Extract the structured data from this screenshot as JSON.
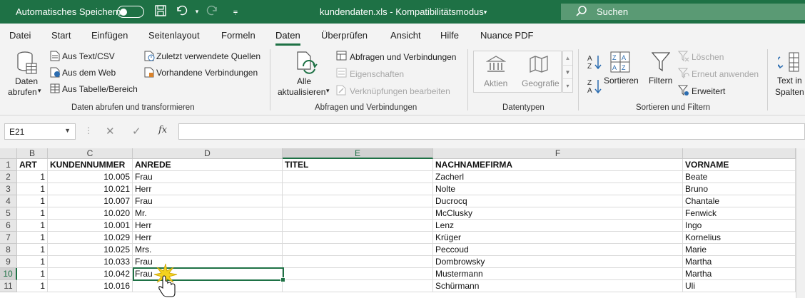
{
  "titlebar": {
    "autosave_label": "Automatisches Speichern",
    "doc_title": "kundendaten.xls  -  Kompatibilitätsmodus",
    "search_label": "Suchen"
  },
  "tabs": [
    "Datei",
    "Start",
    "Einfügen",
    "Seitenlayout",
    "Formeln",
    "Daten",
    "Überprüfen",
    "Ansicht",
    "Hilfe",
    "Nuance PDF"
  ],
  "ribbon": {
    "get_data": {
      "big_line1": "Daten",
      "big_line2": "abrufen",
      "from_text": "Aus Text/CSV",
      "from_web": "Aus dem Web",
      "from_table": "Aus Tabelle/Bereich",
      "recent_sources": "Zuletzt verwendete Quellen",
      "existing_connections": "Vorhandene Verbindungen",
      "group_label": "Daten abrufen und transformieren"
    },
    "queries": {
      "refresh_line1": "Alle",
      "refresh_line2": "aktualisieren",
      "queries_connections": "Abfragen und Verbindungen",
      "properties": "Eigenschaften",
      "edit_links": "Verknüpfungen bearbeiten",
      "group_label": "Abfragen und Verbindungen"
    },
    "datatypes": {
      "stocks": "Aktien",
      "geography": "Geografie",
      "group_label": "Datentypen"
    },
    "sort_filter": {
      "sort": "Sortieren",
      "filter": "Filtern",
      "clear": "Löschen",
      "reapply": "Erneut anwenden",
      "advanced": "Erweitert",
      "group_label": "Sortieren und Filtern"
    },
    "tools": {
      "text_line1": "Text in",
      "text_line2": "Spalten"
    }
  },
  "formula_bar": {
    "name_box": "E21",
    "fx": "fx",
    "value": ""
  },
  "grid": {
    "columns": [
      "B",
      "C",
      "D",
      "E",
      "F"
    ],
    "active_column": "E",
    "rows": [
      {
        "n": "1",
        "art": "ART",
        "kdnr": "KUNDENNUMMER",
        "anrede": "ANREDE",
        "titel": "TITEL",
        "name": "NACHNAMEFIRMA",
        "vorname": "VORNAME"
      },
      {
        "n": "2",
        "art": "1",
        "kdnr": "10.005",
        "anrede": "Frau",
        "titel": "",
        "name": "Zacherl",
        "vorname": "Beate"
      },
      {
        "n": "3",
        "art": "1",
        "kdnr": "10.021",
        "anrede": "Herr",
        "titel": "",
        "name": "Nolte",
        "vorname": "Bruno"
      },
      {
        "n": "4",
        "art": "1",
        "kdnr": "10.007",
        "anrede": "Frau",
        "titel": "",
        "name": "Ducrocq",
        "vorname": "Chantale"
      },
      {
        "n": "5",
        "art": "1",
        "kdnr": "10.020",
        "anrede": "Mr.",
        "titel": "",
        "name": "McClusky",
        "vorname": "Fenwick"
      },
      {
        "n": "6",
        "art": "1",
        "kdnr": "10.001",
        "anrede": "Herr",
        "titel": "",
        "name": "Lenz",
        "vorname": "Ingo"
      },
      {
        "n": "7",
        "art": "1",
        "kdnr": "10.029",
        "anrede": "Herr",
        "titel": "",
        "name": "Krüger",
        "vorname": "Kornelius"
      },
      {
        "n": "8",
        "art": "1",
        "kdnr": "10.025",
        "anrede": "Mrs.",
        "titel": "",
        "name": "Peccoud",
        "vorname": "Marie"
      },
      {
        "n": "9",
        "art": "1",
        "kdnr": "10.033",
        "anrede": "Frau",
        "titel": "",
        "name": "Dombrowsky",
        "vorname": "Martha"
      },
      {
        "n": "10",
        "art": "1",
        "kdnr": "10.042",
        "anrede": "Frau",
        "titel": "",
        "name": "Mustermann",
        "vorname": "Martha"
      },
      {
        "n": "11",
        "art": "1",
        "kdnr": "10.016",
        "anrede": "",
        "titel": "",
        "name": "Schürmann",
        "vorname": "Uli"
      }
    ]
  },
  "colors": {
    "accent": "#1e7145",
    "ribbon_bg": "#f3f3f3"
  }
}
